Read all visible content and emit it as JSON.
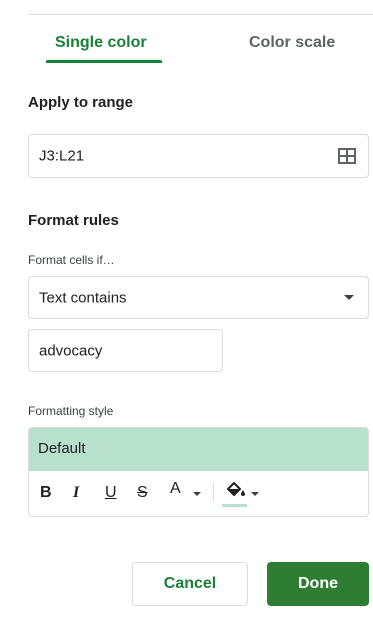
{
  "tabs": [
    {
      "label": "Single color",
      "active": true
    },
    {
      "label": "Color scale",
      "active": false
    }
  ],
  "apply_to_range": {
    "title": "Apply to range",
    "value": "J3:L21",
    "icon": "select-range-grid-icon"
  },
  "format_rules": {
    "title": "Format rules",
    "condition_label": "Format cells if…",
    "condition_value": "Text contains",
    "value_input": "advocacy"
  },
  "formatting_style": {
    "label": "Formatting style",
    "preview_text": "Default",
    "fill_color": "#b7e1cd",
    "toolbar": {
      "bold": "B",
      "italic": "I",
      "underline": "U",
      "strikethrough": "S",
      "text_color": "A"
    }
  },
  "buttons": {
    "cancel": "Cancel",
    "done": "Done"
  },
  "colors": {
    "accent": "#188038",
    "done_button": "#2e7d32",
    "border": "#dadce0"
  }
}
